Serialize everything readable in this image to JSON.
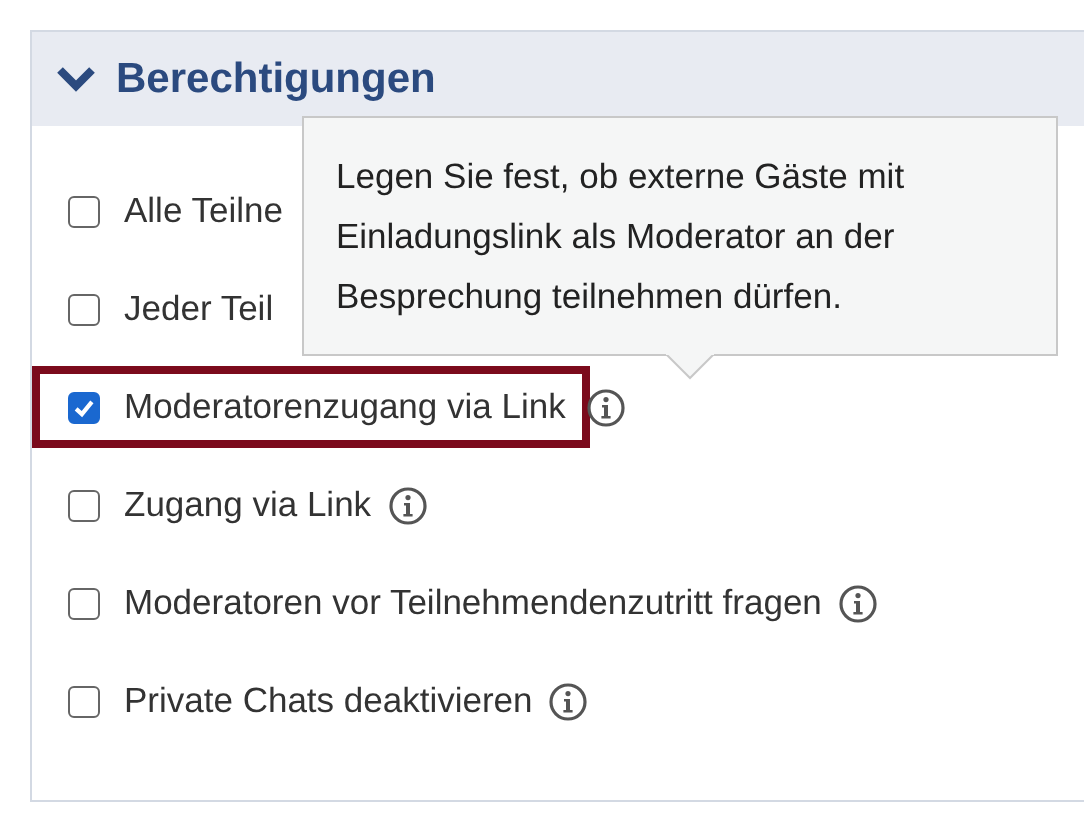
{
  "section": {
    "title": "Berechtigungen",
    "expanded": true
  },
  "options": [
    {
      "label": "Alle Teilne",
      "checked": false,
      "info": false,
      "highlighted": false
    },
    {
      "label": "Jeder Teil",
      "checked": false,
      "info": false,
      "highlighted": false
    },
    {
      "label": "Moderatorenzugang via Link",
      "checked": true,
      "info": true,
      "highlighted": true
    },
    {
      "label": "Zugang via Link",
      "checked": false,
      "info": true,
      "highlighted": false
    },
    {
      "label": "Moderatoren vor Teilnehmendenzutritt fragen",
      "checked": false,
      "info": true,
      "highlighted": false
    },
    {
      "label": "Private Chats deaktivieren",
      "checked": false,
      "info": true,
      "highlighted": false
    }
  ],
  "tooltip": {
    "text": "Legen Sie fest, ob externe Gäste mit Einladungslink als Moderator an der Besprechung teilnehmen dürfen."
  }
}
